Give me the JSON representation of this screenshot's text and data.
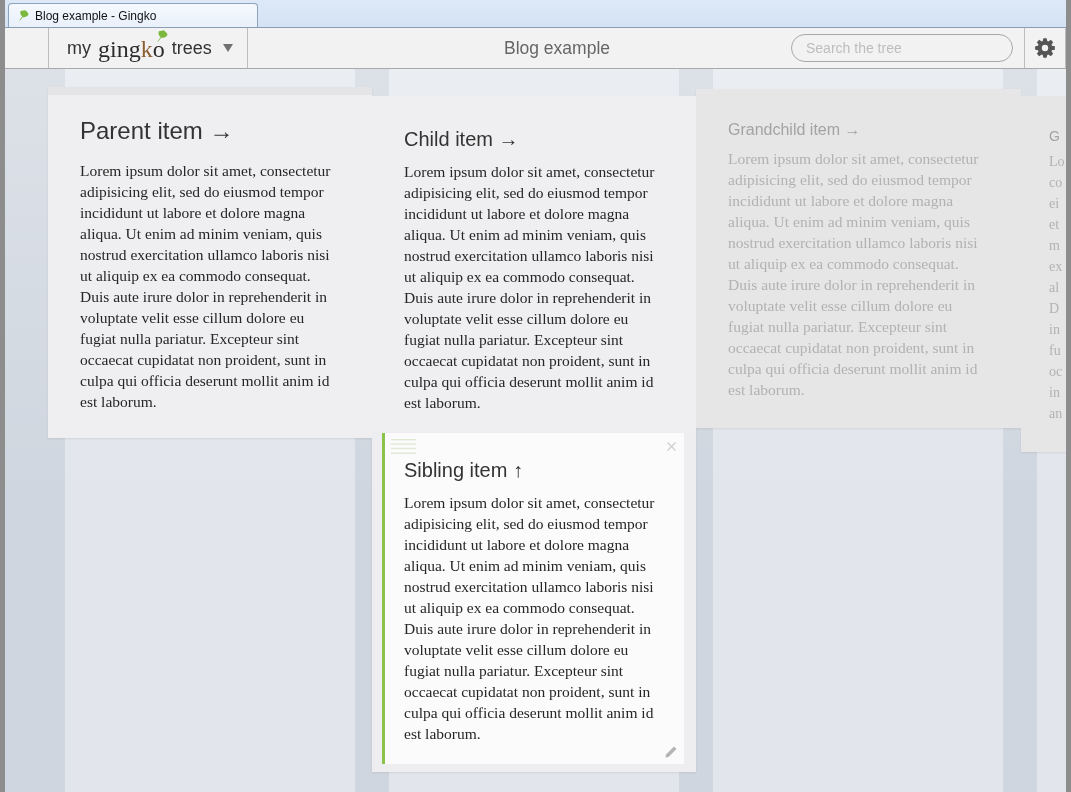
{
  "browser_tab": {
    "title": "Blog example - Gingko"
  },
  "header": {
    "logo": {
      "prefix": "my",
      "brand": [
        {
          "text": "ging",
          "accent": false
        },
        {
          "text": "k",
          "accent": true
        },
        {
          "text": "o",
          "accent": false
        }
      ],
      "suffix": "trees"
    },
    "title": "Blog example",
    "search": {
      "placeholder": "Search the tree"
    }
  },
  "columns": [
    {
      "cards": [
        {
          "kind": "h1",
          "title": "Parent item →",
          "body": "Lorem ipsum dolor sit amet, consectetur adipisicing elit, sed do eiusmod tempor incididunt ut labore et dolore magna aliqua. Ut enim ad minim veniam, quis nostrud exercitation ullamco laboris nisi ut aliquip ex ea commodo consequat. Duis aute irure dolor in reprehenderit in voluptate velit esse cillum dolore eu fugiat nulla pariatur. Excepteur sint occaecat cupidatat non proident, sunt in culpa qui officia deserunt mollit anim id est laborum.",
          "selected": false,
          "dimmed": false
        }
      ]
    },
    {
      "cards": [
        {
          "kind": "h2",
          "title": "Child item →",
          "body": "Lorem ipsum dolor sit amet, consectetur adipisicing elit, sed do eiusmod tempor incididunt ut labore et dolore magna aliqua. Ut enim ad minim veniam, quis nostrud exercitation ullamco laboris nisi ut aliquip ex ea commodo consequat. Duis aute irure dolor in reprehenderit in voluptate velit esse cillum dolore eu fugiat nulla pariatur. Excepteur sint occaecat cupidatat non proident, sunt in culpa qui officia deserunt mollit anim id est laborum.",
          "selected": false,
          "dimmed": false
        },
        {
          "kind": "h2",
          "title": "Sibling item ↑",
          "body": "Lorem ipsum dolor sit amet, consectetur adipisicing elit, sed do eiusmod tempor incididunt ut labore et dolore magna aliqua. Ut enim ad minim veniam, quis nostrud exercitation ullamco laboris nisi ut aliquip ex ea commodo consequat. Duis aute irure dolor in reprehenderit in voluptate velit esse cillum dolore eu fugiat nulla pariatur. Excepteur sint occaecat cupidatat non proident, sunt in culpa qui officia deserunt mollit anim id est laborum.",
          "selected": true,
          "dimmed": false
        }
      ]
    },
    {
      "cards": [
        {
          "kind": "h3",
          "title": "Grandchild item →",
          "body": "Lorem ipsum dolor sit amet, consectetur adipisicing elit, sed do eiusmod tempor incididunt ut labore et dolore magna aliqua. Ut enim ad minim veniam, quis nostrud exercitation ullamco laboris nisi ut aliquip ex ea commodo consequat. Duis aute irure dolor in reprehenderit in voluptate velit esse cillum dolore eu fugiat nulla pariatur. Excepteur sint occaecat cupidatat non proident, sunt in culpa qui officia deserunt mollit anim id est laborum.",
          "selected": false,
          "dimmed": true
        }
      ]
    },
    {
      "cards": [
        {
          "kind": "h4",
          "title": "G",
          "body_lines": [
            "Lo",
            "co",
            "ei",
            "et",
            "m",
            "ex",
            "al",
            "D",
            "in",
            "fu",
            "oc",
            "in",
            "an"
          ],
          "selected": false,
          "dimmed": true
        }
      ]
    }
  ]
}
